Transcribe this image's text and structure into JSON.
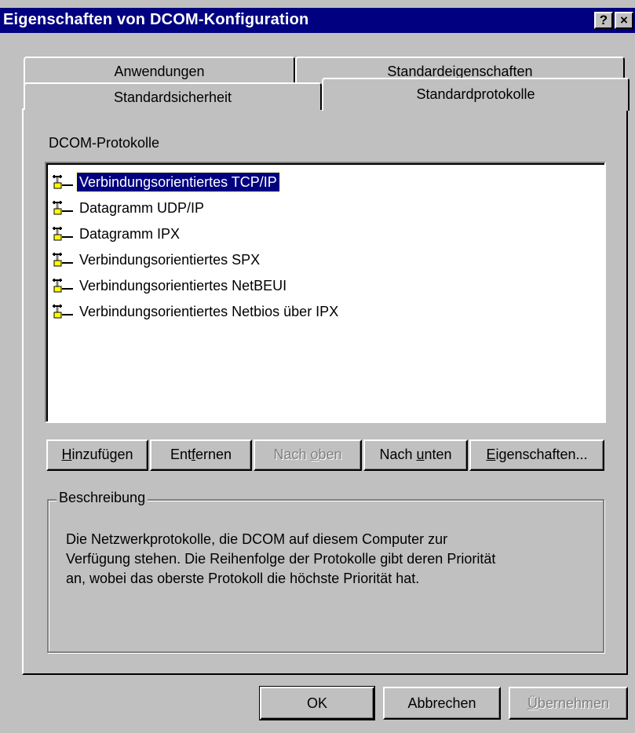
{
  "window": {
    "title": "Eigenschaften von DCOM-Konfiguration",
    "help_button": "?",
    "close_button": "×"
  },
  "tabs": [
    {
      "label": "Anwendungen"
    },
    {
      "label": "Standardeigenschaften"
    },
    {
      "label": "Standardsicherheit"
    },
    {
      "label": "Standardprotokolle",
      "active": true
    }
  ],
  "protocols": {
    "label": "DCOM-Protokolle",
    "items": [
      {
        "label": "Verbindungsorientiertes TCP/IP",
        "selected": true,
        "icon": "network-protocol-icon"
      },
      {
        "label": "Datagramm UDP/IP",
        "icon": "network-protocol-icon"
      },
      {
        "label": "Datagramm IPX",
        "icon": "network-protocol-icon"
      },
      {
        "label": "Verbindungsorientiertes SPX",
        "icon": "network-protocol-icon"
      },
      {
        "label": "Verbindungsorientiertes NetBEUI",
        "icon": "network-protocol-icon"
      },
      {
        "label": "Verbindungsorientiertes Netbios über IPX",
        "icon": "network-protocol-icon"
      }
    ]
  },
  "list_buttons": {
    "add": {
      "pre": "",
      "key": "H",
      "post": "inzufügen"
    },
    "remove": {
      "pre": "Ent",
      "key": "f",
      "post": "ernen"
    },
    "up": {
      "pre": "Nach ",
      "key": "o",
      "post": "ben",
      "disabled": true
    },
    "down": {
      "pre": "Nach ",
      "key": "u",
      "post": "nten"
    },
    "props": {
      "pre": "",
      "key": "E",
      "post": "igenschaften..."
    }
  },
  "description": {
    "title": "Beschreibung",
    "line1": "Die Netzwerkprotokolle, die DCOM auf diesem Computer zur",
    "line2": "Verfügung stehen. Die Reihenfolge der Protokolle gibt deren Priorität",
    "line3": "an, wobei das oberste Protokoll die höchste Priorität hat."
  },
  "dialog_buttons": {
    "ok": "OK",
    "cancel": "Abbrechen",
    "apply": {
      "pre": "",
      "key": "Ü",
      "post": "bernehmen",
      "disabled": true
    }
  },
  "colors": {
    "title_bar": "#000080",
    "face": "#c0c0c0",
    "selection": "#000080"
  }
}
